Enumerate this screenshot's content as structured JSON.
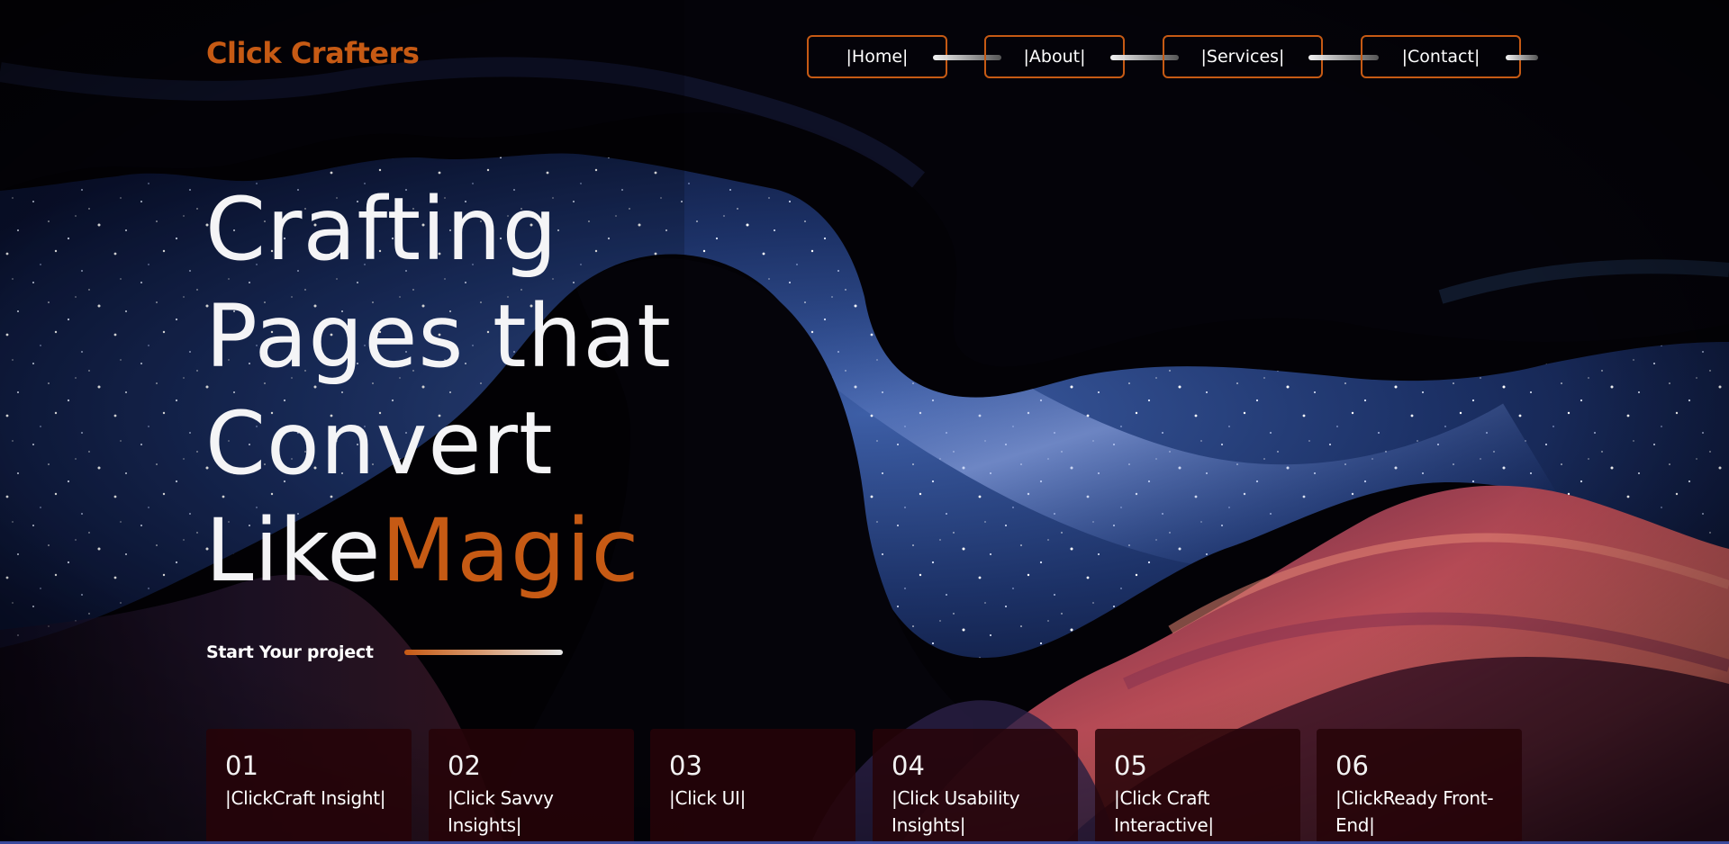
{
  "header": {
    "brand": "Click Crafters",
    "nav": [
      {
        "label": "|Home|"
      },
      {
        "label": "|About|"
      },
      {
        "label": "|Services|"
      },
      {
        "label": "|Contact|"
      }
    ]
  },
  "hero": {
    "title_lines": [
      "Crafting",
      "Pages that",
      "Convert"
    ],
    "last_line_plain": "Like",
    "last_line_accent": "Magic",
    "cta_label": "Start Your project"
  },
  "cards": [
    {
      "number": "01",
      "title": "|ClickCraft Insight|"
    },
    {
      "number": "02",
      "title": "|Click Savvy Insights|"
    },
    {
      "number": "03",
      "title": "|Click UI|"
    },
    {
      "number": "04",
      "title": "|Click Usability Insights|"
    },
    {
      "number": "05",
      "title": "|Click Craft Interactive|"
    },
    {
      "number": "06",
      "title": "|ClickReady Front-End|"
    }
  ],
  "colors": {
    "accent": "#c65a14",
    "background": "#030206",
    "card_bg": "#260408",
    "text": "#ffffff"
  },
  "icons": {
    "background": "night-sky-canyon-image"
  }
}
